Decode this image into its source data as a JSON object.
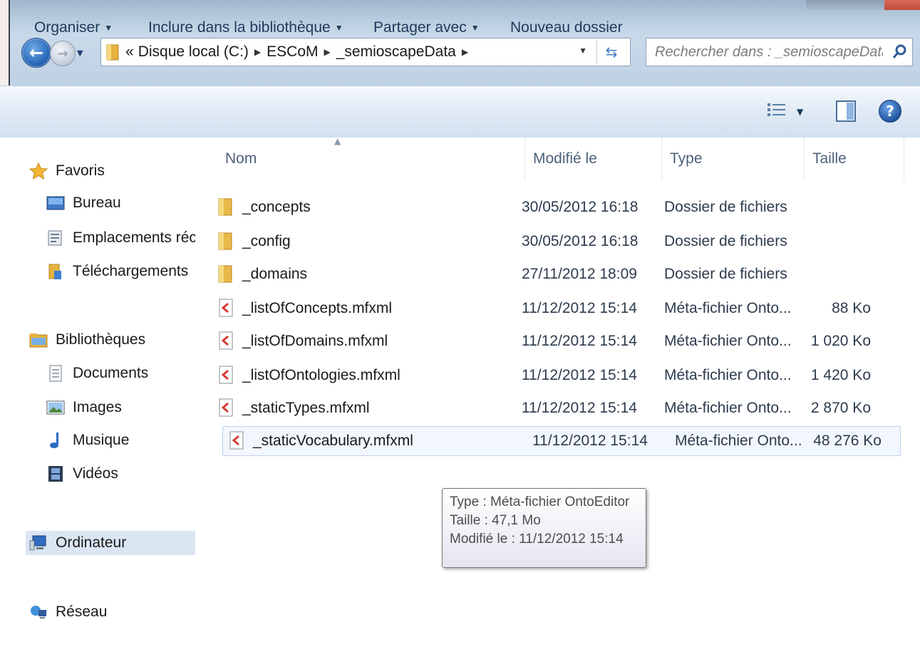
{
  "address_bar": {
    "overflow": "«",
    "crumbs": [
      "Disque local (C:)",
      "ESCoM",
      "_semioscapeData"
    ]
  },
  "search": {
    "placeholder": "Rechercher dans : _semioscapeData"
  },
  "toolbar": {
    "organize_label": "Organiser",
    "include_label": "Inclure dans la bibliothèque",
    "share_label": "Partager avec",
    "new_folder_label": "Nouveau dossier"
  },
  "nav_pane": {
    "favorites": "Favoris",
    "desktop": "Bureau",
    "recent": "Emplacements récen",
    "downloads": "Téléchargements",
    "libraries": "Bibliothèques",
    "documents": "Documents",
    "pictures": "Images",
    "music": "Musique",
    "videos": "Vidéos",
    "computer": "Ordinateur",
    "network": "Réseau"
  },
  "columns": {
    "name": "Nom",
    "modified": "Modifié le",
    "type": "Type",
    "size": "Taille"
  },
  "files": [
    {
      "name": "_concepts",
      "modified": "30/05/2012 16:18",
      "type": "Dossier de fichiers",
      "size": ""
    },
    {
      "name": "_config",
      "modified": "30/05/2012 16:18",
      "type": "Dossier de fichiers",
      "size": ""
    },
    {
      "name": "_domains",
      "modified": "27/11/2012 18:09",
      "type": "Dossier de fichiers",
      "size": ""
    },
    {
      "name": "_listOfConcepts.mfxml",
      "modified": "11/12/2012 15:14",
      "type": "Méta-fichier Onto...",
      "size": "88 Ko"
    },
    {
      "name": "_listOfDomains.mfxml",
      "modified": "11/12/2012 15:14",
      "type": "Méta-fichier Onto...",
      "size": "1 020 Ko"
    },
    {
      "name": "_listOfOntologies.mfxml",
      "modified": "11/12/2012 15:14",
      "type": "Méta-fichier Onto...",
      "size": "1 420 Ko"
    },
    {
      "name": "_staticTypes.mfxml",
      "modified": "11/12/2012 15:14",
      "type": "Méta-fichier Onto...",
      "size": "2 870 Ko"
    },
    {
      "name": "_staticVocabulary.mfxml",
      "modified": "11/12/2012 15:14",
      "type": "Méta-fichier Onto...",
      "size": "48 276 Ko"
    }
  ],
  "tooltip": {
    "type_line": "Type : Méta-fichier OntoEditor",
    "size_line": "Taille : 47,1 Mo",
    "modified_line": "Modifié le : 11/12/2012 15:14"
  },
  "colors": {
    "command_bar": "#dfe9f5",
    "selection": "#dbe6f3",
    "folder": "#e8b94a",
    "file_accent": "#d43c32"
  }
}
